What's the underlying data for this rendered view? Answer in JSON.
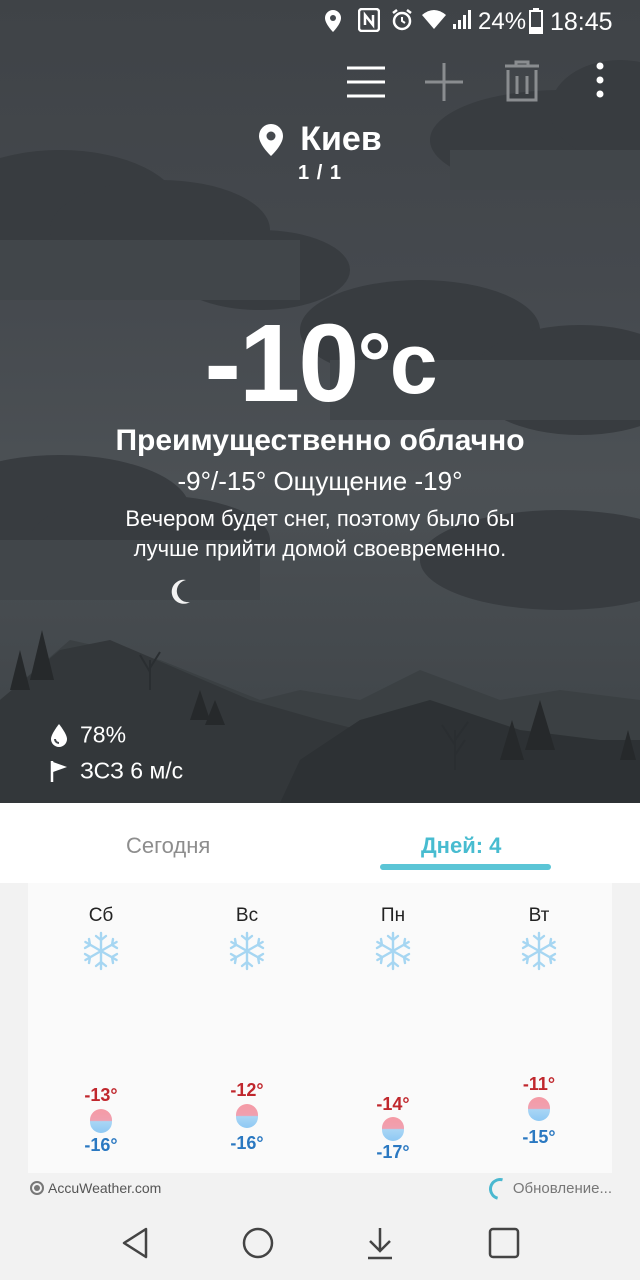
{
  "status_bar": {
    "battery_percent": "24%",
    "time": "18:45",
    "icons": [
      "location-icon",
      "nfc-icon",
      "alarm-icon",
      "wifi-icon",
      "signal-icon",
      "battery-icon"
    ]
  },
  "toolbar": {
    "icons": [
      "menu-icon",
      "add-icon",
      "delete-icon",
      "more-icon"
    ]
  },
  "location": {
    "city": "Киев",
    "page_indicator": "1 / 1"
  },
  "current": {
    "temperature": "-10",
    "unit": "°c",
    "condition": "Преимущественно облачно",
    "min_max_feels": "-9°/-15° Ощущение -19°",
    "advice": "Вечером будет снег, поэтому было бы лучше прийти домой своевременно.",
    "humidity": "78%",
    "wind": "ЗСЗ 6 м/с"
  },
  "tabs": {
    "today": "Сегодня",
    "days": "Дней: 4",
    "active": "days"
  },
  "forecast": [
    {
      "day": "Сб",
      "high": "-13°",
      "low": "-16°",
      "icon": "snowflake-icon"
    },
    {
      "day": "Вс",
      "high": "-12°",
      "low": "-16°",
      "icon": "snowflake-icon"
    },
    {
      "day": "Пн",
      "high": "-14°",
      "low": "-17°",
      "icon": "snowflake-icon"
    },
    {
      "day": "Вт",
      "high": "-11°",
      "low": "-15°",
      "icon": "snowflake-icon"
    }
  ],
  "footer": {
    "brand": "AccuWeather.com",
    "update_status": "Обновление..."
  },
  "colors": {
    "accent": "#48bcd0",
    "high_temp": "#c0272d",
    "low_temp": "#2a78c1",
    "hero_bg": "#45494e"
  }
}
